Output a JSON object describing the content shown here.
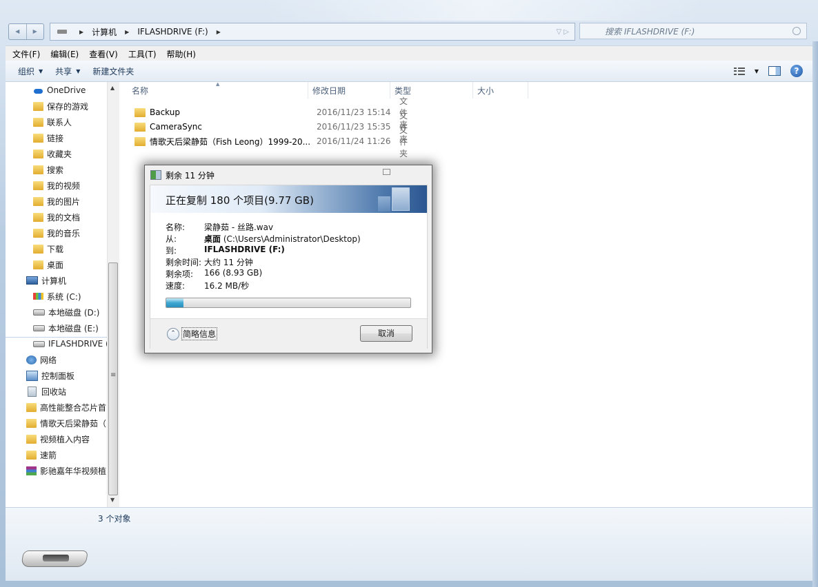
{
  "window": {
    "address": {
      "crumbs": [
        "计算机",
        "IFLASHDRIVE (F:)"
      ]
    },
    "search_placeholder": "搜索 IFLASHDRIVE (F:)"
  },
  "menubar": [
    "文件(F)",
    "编辑(E)",
    "查看(V)",
    "工具(T)",
    "帮助(H)"
  ],
  "toolbar": {
    "organize": "组织",
    "share": "共享",
    "new_folder": "新建文件夹"
  },
  "nav": {
    "items": [
      {
        "label": "OneDrive",
        "icon": "onedrive-icon"
      },
      {
        "label": "保存的游戏",
        "icon": "folder-icon"
      },
      {
        "label": "联系人",
        "icon": "folder-icon"
      },
      {
        "label": "链接",
        "icon": "folder-icon"
      },
      {
        "label": "收藏夹",
        "icon": "folder-icon"
      },
      {
        "label": "搜索",
        "icon": "folder-icon"
      },
      {
        "label": "我的视频",
        "icon": "folder-icon"
      },
      {
        "label": "我的图片",
        "icon": "folder-icon"
      },
      {
        "label": "我的文档",
        "icon": "folder-icon"
      },
      {
        "label": "我的音乐",
        "icon": "folder-icon"
      },
      {
        "label": "下载",
        "icon": "folder-icon"
      },
      {
        "label": "桌面",
        "icon": "folder-icon"
      },
      {
        "label": "计算机",
        "icon": "computer-icon"
      },
      {
        "label": "系统 (C:)",
        "icon": "system-disk-icon"
      },
      {
        "label": "本地磁盘 (D:)",
        "icon": "disk-icon"
      },
      {
        "label": "本地磁盘 (E:)",
        "icon": "disk-icon"
      },
      {
        "label": "IFLASHDRIVE (F:)",
        "icon": "usb-drive-icon"
      },
      {
        "label": "网络",
        "icon": "network-icon"
      },
      {
        "label": "控制面板",
        "icon": "control-panel-icon"
      },
      {
        "label": "回收站",
        "icon": "recycle-bin-icon"
      },
      {
        "label": "高性能整合芯片首",
        "icon": "folder-icon"
      },
      {
        "label": "情歌天后梁静茹（",
        "icon": "folder-icon"
      },
      {
        "label": "视频植入内容",
        "icon": "folder-icon"
      },
      {
        "label": "速箭",
        "icon": "folder-icon"
      },
      {
        "label": "影驰嘉年华视频植",
        "icon": "winrar-icon"
      }
    ]
  },
  "columns": [
    "名称",
    "修改日期",
    "类型",
    "大小"
  ],
  "files": [
    {
      "name": "Backup",
      "date": "2016/11/23 15:14",
      "type": "文件夹"
    },
    {
      "name": "CameraSync",
      "date": "2016/11/23 15:35",
      "type": "文件夹"
    },
    {
      "name": "情歌天后梁静茹（Fish Leong）1999-20...",
      "date": "2016/11/24 11:26",
      "type": "文件夹"
    }
  ],
  "status": {
    "count": "3 个对象"
  },
  "dialog": {
    "title": "剩余 11 分钟",
    "heading": "正在复制 180 个项目(9.77 GB)",
    "name_label": "名称:",
    "name_value": "梁静茹 - 丝路.wav",
    "from_label": "从:",
    "from_bold": "桌面",
    "from_path": " (C:\\Users\\Administrator\\Desktop)",
    "to_label": "到:",
    "to_value": "IFLASHDRIVE (F:)",
    "time_label": "剩余时间:",
    "time_value": "大约 11 分钟",
    "items_label": "剩余项:",
    "items_value": "166 (8.93 GB)",
    "speed_label": "速度:",
    "speed_value": "16.2 MB/秒",
    "progress_fraction": 0.07,
    "less_info": "简略信息",
    "cancel": "取消"
  }
}
